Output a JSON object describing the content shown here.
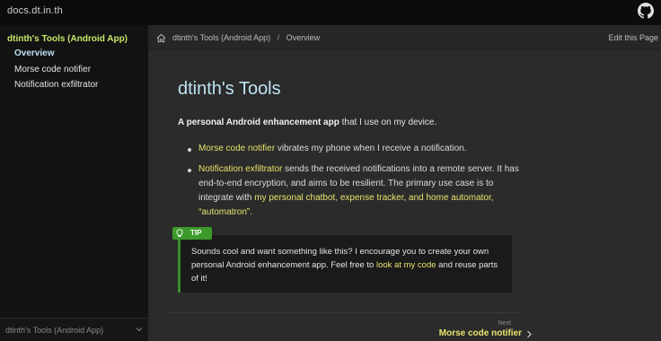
{
  "header": {
    "site_title": "docs.dt.in.th",
    "github_icon": "github-icon"
  },
  "sidebar": {
    "section_label": "dtinth's Tools (Android App)",
    "items": [
      {
        "label": "Overview",
        "active": true
      },
      {
        "label": "Morse code notifier",
        "active": false
      },
      {
        "label": "Notification exfiltrator",
        "active": false
      }
    ],
    "footer_label": "dtinth's Tools (Android App)",
    "footer_icon": "chevron-down-icon"
  },
  "breadcrumb": {
    "home_icon": "home-icon",
    "section": "dtinth's Tools (Android App)",
    "separator": "/",
    "current": "Overview",
    "edit_label": "Edit this Page"
  },
  "content": {
    "title": "dtinth's Tools",
    "intro_bold": "A personal Android enhancement app",
    "intro_rest": " that I use on my device.",
    "bullet1": {
      "link": "Morse code notifier",
      "text": " vibrates my phone when I receive a notification."
    },
    "bullet2": {
      "link": "Notification exfiltrator",
      "text1": " sends the received notifications into a remote server. It has end-to-end encryption, and aims to be resilient. The primary use case is to integrate with ",
      "link2": "my personal chatbot, expense tracker, and home automator, “automatron”",
      "text2": "."
    }
  },
  "tip": {
    "label": "TIP",
    "icon": "lightbulb-icon",
    "text1": "Sounds cool and want something like this? I encourage you to create your own personal Android enhancement app. Feel free to ",
    "link": "look at my code",
    "text2": " and reuse parts of it!"
  },
  "pagination": {
    "caption": "Next",
    "label": "Morse code notifier",
    "icon": "chevron-right-icon"
  },
  "colors": {
    "accent_link": "#e8e36c",
    "sidebar_section": "#c7e76a",
    "title": "#bde3f2",
    "tip_green": "#3c9a2b"
  }
}
